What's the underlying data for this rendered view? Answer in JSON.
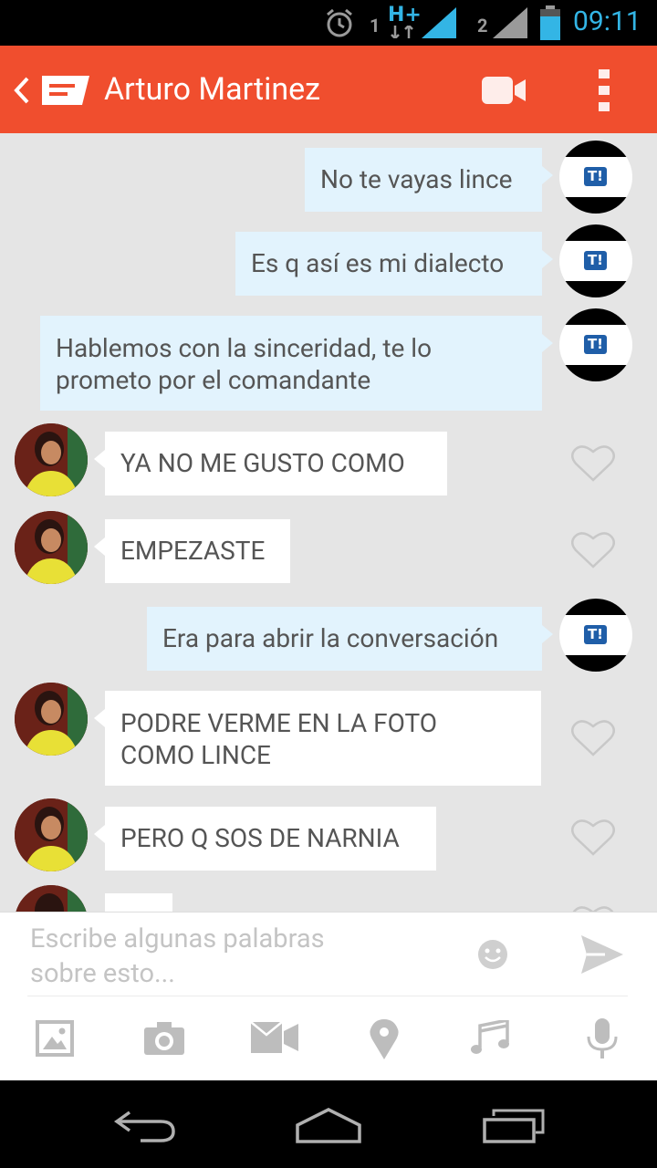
{
  "status_bar": {
    "sim1_label": "1",
    "network_type": "H+",
    "sim2_label": "2",
    "time": "09:11",
    "icons": [
      "alarm-icon",
      "signal-icon",
      "battery-icon"
    ]
  },
  "app_bar": {
    "contact_name": "Arturo Martinez",
    "icons": [
      "back-chevron-icon",
      "message-icon",
      "video-call-icon",
      "overflow-menu-icon"
    ]
  },
  "messages": [
    {
      "direction": "out",
      "lines": [
        "No te vayas lince"
      ]
    },
    {
      "direction": "out",
      "lines": [
        "Es q así es mi dialecto"
      ]
    },
    {
      "direction": "out",
      "lines": [
        "Hablemos con la sinceridad, te lo",
        "prometo por el comandante"
      ]
    },
    {
      "direction": "in",
      "lines": [
        "YA NO ME GUSTO COMO"
      ]
    },
    {
      "direction": "in",
      "lines": [
        "EMPEZASTE"
      ]
    },
    {
      "direction": "out",
      "lines": [
        "Era para abrir la conversación"
      ]
    },
    {
      "direction": "in",
      "lines": [
        "PODRE VERME EN LA FOTO",
        "COMO LINCE"
      ]
    },
    {
      "direction": "in",
      "lines": [
        "PERO Q SOS DE NARNIA"
      ]
    }
  ],
  "outgoing_avatar_logo": "T!",
  "composer": {
    "placeholder_line1": "Escribe algunas palabras",
    "placeholder_line2": "sobre esto...",
    "icons": [
      "emoji-icon",
      "send-icon"
    ]
  },
  "attachment_toolbar": [
    "image-icon",
    "camera-icon",
    "video-icon",
    "location-icon",
    "music-icon",
    "microphone-icon"
  ],
  "nav_bar": [
    "back-icon",
    "home-icon",
    "recent-apps-icon"
  ],
  "colors": {
    "accent": "#f04e2e",
    "status_blue": "#33b5e5",
    "outgoing_bubble": "#e2f3fd",
    "incoming_bubble": "#ffffff",
    "chat_background": "#e5e5e5"
  }
}
